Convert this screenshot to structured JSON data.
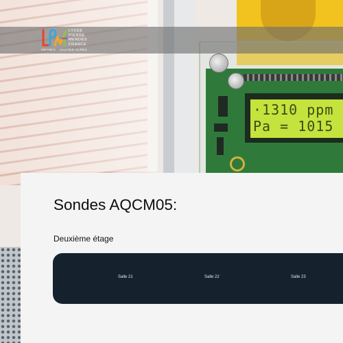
{
  "header": {
    "logo": {
      "lines": [
        "LYCÉE",
        "PIERRE",
        "MENDÈS",
        "FRANCE"
      ],
      "city": "VEYNES - HAUTES-ALPES",
      "colors": [
        "#e8442c",
        "#f5a623",
        "#3aa7d9",
        "#8bc34a",
        "#9b59b6"
      ]
    }
  },
  "hero": {
    "lcd_line1": "·1310 ppm",
    "lcd_line2": "Pa = 1015"
  },
  "main": {
    "title": "Sondes AQCM05:",
    "floor_label": "Deuxième étage",
    "rooms": [
      {
        "label": "Salle 21"
      },
      {
        "label": "Salle 22"
      },
      {
        "label": "Salle 23"
      }
    ]
  },
  "colors": {
    "rooms_bar": "#15222e",
    "card_bg": "#f4f4f4",
    "header_band": "#6e6e6e",
    "lcd": "#c4e33d"
  }
}
